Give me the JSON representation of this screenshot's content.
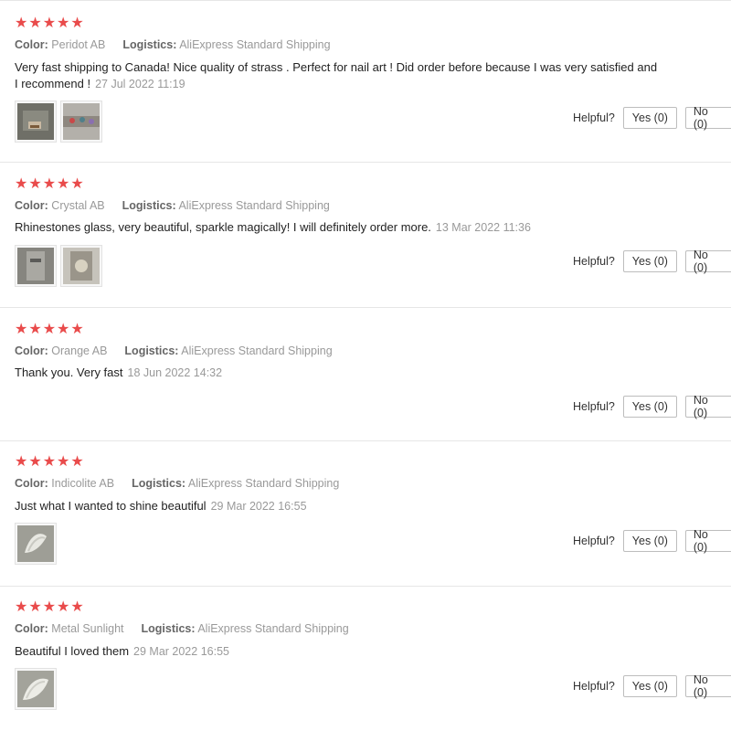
{
  "helpful_label": "Helpful?",
  "color_label": "Color:",
  "logistics_label": "Logistics:",
  "stars": "★★★★★",
  "reviews": [
    {
      "color": "Peridot AB",
      "logistics": "AliExpress Standard Shipping",
      "text": "Very fast shipping to Canada! Nice quality of strass . Perfect for nail art ! Did order before because I was very satisfied and I recommend !",
      "date": "27 Jul 2022 11:19",
      "rating": 5,
      "yes": "Yes (0)",
      "no": "No (0)",
      "photo_count": 2
    },
    {
      "color": "Crystal AB",
      "logistics": "AliExpress Standard Shipping",
      "text": "Rhinestones glass, very beautiful, sparkle magically! I will definitely order more.",
      "date": "13 Mar 2022 11:36",
      "rating": 5,
      "yes": "Yes (0)",
      "no": "No (0)",
      "photo_count": 2
    },
    {
      "color": "Orange AB",
      "logistics": "AliExpress Standard Shipping",
      "text": "Thank you. Very fast",
      "date": "18 Jun 2022 14:32",
      "rating": 5,
      "yes": "Yes (0)",
      "no": "No (0)",
      "photo_count": 0
    },
    {
      "color": "Indicolite AB",
      "logistics": "AliExpress Standard Shipping",
      "text": "Just what I wanted to shine beautiful",
      "date": "29 Mar 2022 16:55",
      "rating": 5,
      "yes": "Yes (0)",
      "no": "No (0)",
      "photo_count": 1
    },
    {
      "color": "Metal Sunlight",
      "logistics": "AliExpress Standard Shipping",
      "text": "Beautiful I loved them",
      "date": "29 Mar 2022 16:55",
      "rating": 5,
      "yes": "Yes (0)",
      "no": "No (0)",
      "photo_count": 1
    }
  ],
  "colors": {
    "star": "#e94b4b",
    "divider": "#e6e6e6",
    "muted": "#999999"
  }
}
